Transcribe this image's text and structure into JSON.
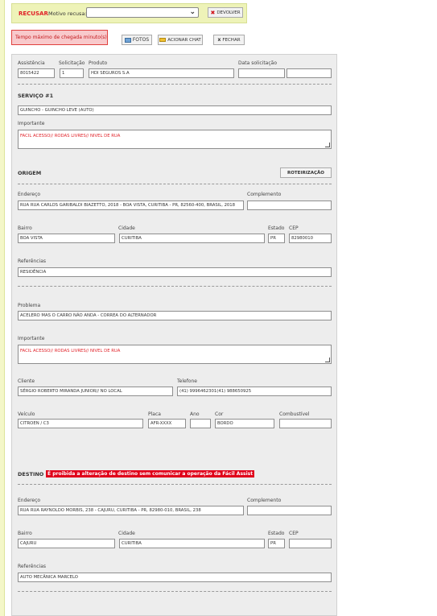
{
  "topbar": {
    "recusar_label": "RECUSAR",
    "motivo_label": "Motivo recusa:",
    "motivo_value": "",
    "devolver_label": "DEVOLVER"
  },
  "alert": {
    "text": "Tempo máximo de chegada minuto(s)"
  },
  "actions": {
    "fotos": "FOTOS",
    "chat": "ACIONAR CHAT",
    "fechar": "FECHAR"
  },
  "header": {
    "assistencia_label": "Assistência",
    "assistencia_value": "8015422",
    "solicitacao_label": "Solicitação",
    "solicitacao_value": "1",
    "produto_label": "Produto",
    "produto_value": "HDI SEGUROS S.A",
    "data_label": "Data solicitação",
    "data_value": "",
    "hora_value": ""
  },
  "servico": {
    "title": "SERVIÇO #1",
    "value": "GUINCHO - GUINCHO LEVE (AUTO)",
    "importante_label": "Importante",
    "importante_value": "FACIL ACESSO// RODAS LIVRES// NIVEL DE RUA"
  },
  "origem": {
    "title": "ORIGEM",
    "roteirizacao": "ROTEIRIZAÇÃO",
    "endereco_label": "Endereço",
    "endereco_value": "RUA RUA CARLOS GARIBALDI BIAZETTO, 2018 - BOA VISTA, CURITIBA - PR, 82560-400, BRASIL, 2018",
    "complemento_label": "Complemento",
    "complemento_value": "",
    "bairro_label": "Bairro",
    "bairro_value": "BOA VISTA",
    "cidade_label": "Cidade",
    "cidade_value": "CURITIBA",
    "estado_label": "Estado",
    "estado_value": "PR",
    "cep_label": "CEP",
    "cep_value": "82980010",
    "referencias_label": "Referências",
    "referencias_value": "RESIDÊNCIA"
  },
  "problema": {
    "label": "Problema",
    "value": "ACELERO MAS O CARRO NÃO ANDA - CORREA DO ALTERNADOR",
    "importante_label": "Importante",
    "importante_value": "FACIL ACESSO// RODAS LIVRES// NIVEL DE RUA",
    "cliente_label": "Cliente",
    "cliente_value": "SÉRGIO ROBERTO MIRANDA JUNIOR// NO LOCAL",
    "telefone_label": "Telefone",
    "telefone_value": "(41) 9996462301(41) 988650925",
    "veiculo_label": "Veículo",
    "veiculo_value": "CITROEN / C3",
    "placa_label": "Placa",
    "placa_value": "AFR-XXXX",
    "ano_label": "Ano",
    "ano_value": "",
    "cor_label": "Cor",
    "cor_value": "BORDO",
    "combustivel_label": "Combustível",
    "combustivel_value": ""
  },
  "destino": {
    "title": "DESTINO",
    "warning": "É proibida a alteração de destino sem comunicar a operação da Fácil Assist",
    "endereco_label": "Endereço",
    "endereco_value": "RUA RUA RAYNOLDO MORBIS, 238 - CAJURU, CURITIBA - PR, 82980-010, BRASIL, 238",
    "complemento_label": "Complemento",
    "complemento_value": "",
    "bairro_label": "Bairro",
    "bairro_value": "CAJURU",
    "cidade_label": "Cidade",
    "cidade_value": "CURITIBA",
    "estado_label": "Estado",
    "estado_value": "PR",
    "cep_label": "CEP",
    "cep_value": "",
    "referencias_label": "Referências",
    "referencias_value": "AUTO MECÂNICA MARCELO"
  }
}
